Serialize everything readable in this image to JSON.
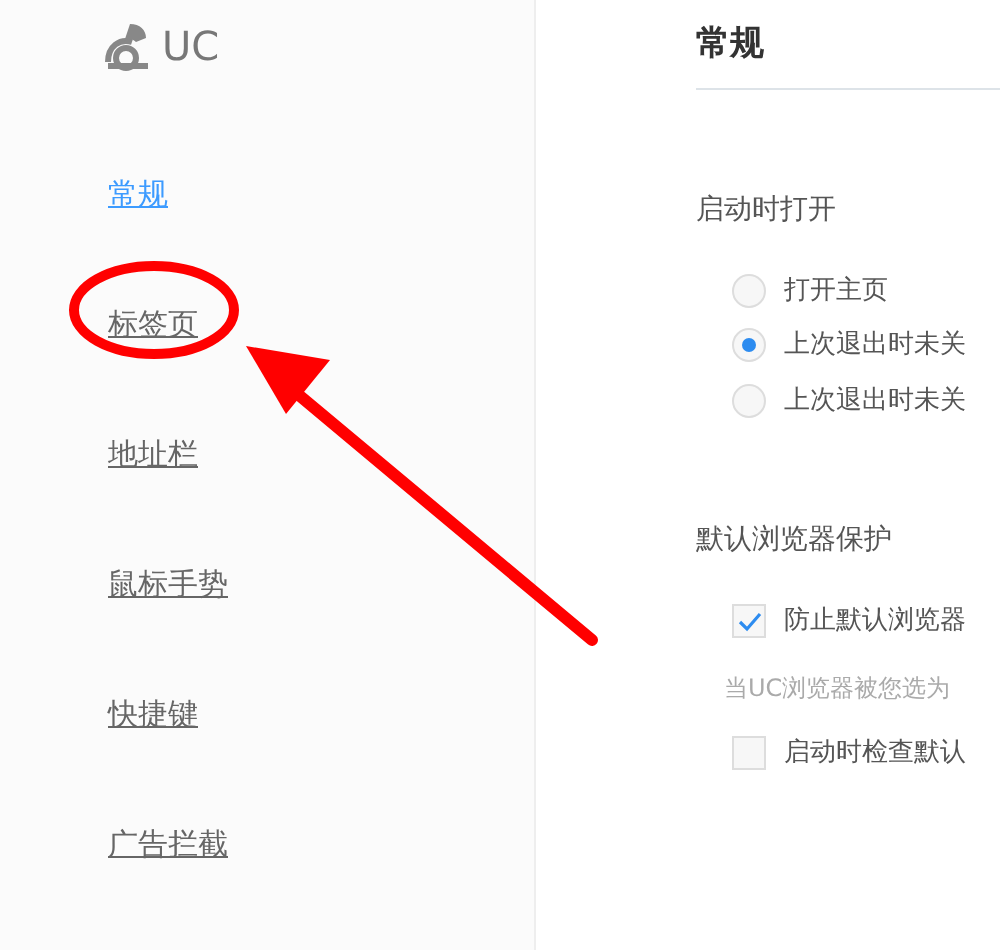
{
  "logo": {
    "text": "UC"
  },
  "sidebar": {
    "items": [
      {
        "label": "常规",
        "selected": true
      },
      {
        "label": "标签页",
        "selected": false
      },
      {
        "label": "地址栏",
        "selected": false
      },
      {
        "label": "鼠标手势",
        "selected": false
      },
      {
        "label": "快捷键",
        "selected": false
      },
      {
        "label": "广告拦截",
        "selected": false
      }
    ]
  },
  "main": {
    "title": "常规",
    "sections": [
      {
        "heading": "启动时打开",
        "items": [
          {
            "kind": "radio",
            "label": "打开主页",
            "selected": false
          },
          {
            "kind": "radio",
            "label": "上次退出时未关",
            "selected": true
          },
          {
            "kind": "radio",
            "label": "上次退出时未关",
            "selected": false
          }
        ]
      },
      {
        "heading": "默认浏览器保护",
        "items": [
          {
            "kind": "checkbox",
            "label": "防止默认浏览器",
            "checked": true
          },
          {
            "kind": "hint",
            "label": "当UC浏览器被您选为"
          },
          {
            "kind": "checkbox",
            "label": "启动时检查默认",
            "checked": false
          }
        ]
      }
    ]
  }
}
